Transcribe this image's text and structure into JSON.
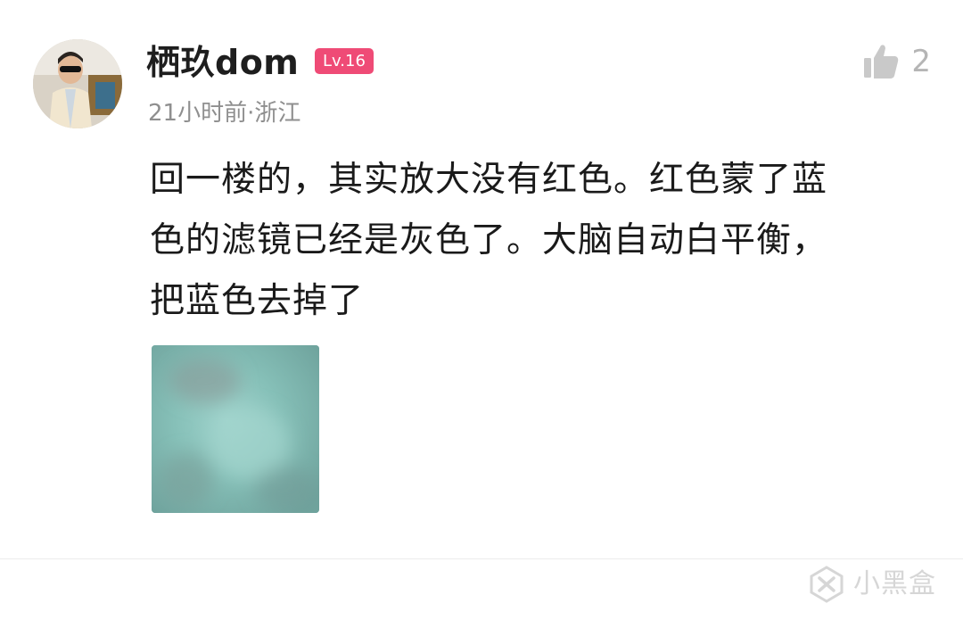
{
  "comment": {
    "author": {
      "name": "栖玖dom",
      "level": "Lv.16",
      "avatar": "user-avatar-photo"
    },
    "meta": "21小时前·浙江",
    "likes": {
      "icon": "thumbs-up-icon",
      "count": "2"
    },
    "text": "回一楼的，其实放大没有红色。红色蒙了蓝\n色的滤镜已经是灰色了。大脑自动白平衡，\n把蓝色去掉了",
    "attachment": {
      "type": "image",
      "description_color": "#7fb7b0"
    }
  },
  "watermark": {
    "text": "小黑盒",
    "icon": "xiaoheihe-logo-icon"
  },
  "colors": {
    "badge": "#ef4b76",
    "meta_text": "#8f8f8f",
    "like_icon": "#c9c9c9"
  }
}
